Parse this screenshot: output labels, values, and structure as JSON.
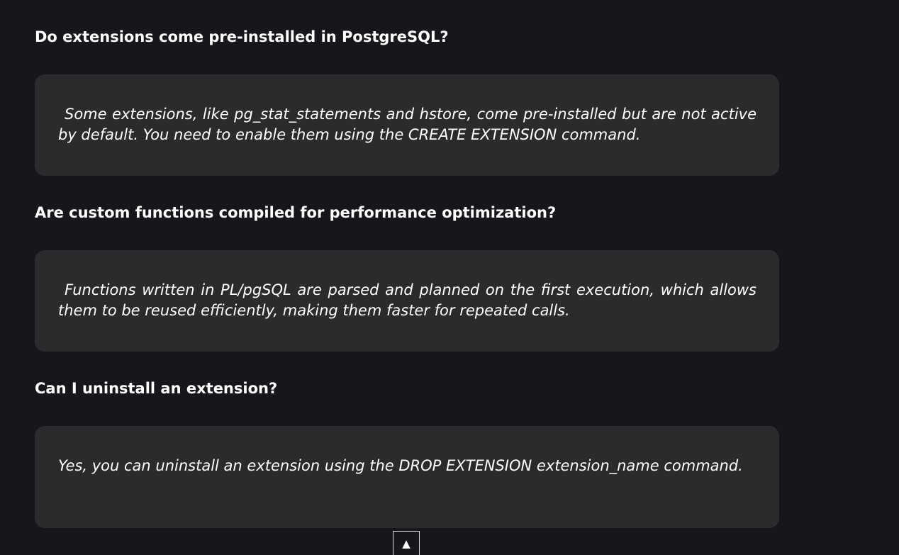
{
  "faq": [
    {
      "question": "Do extensions come pre-installed in PostgreSQL?",
      "answer": "Some extensions, like pg_stat_statements and hstore, come pre-installed but are not active by default. You need to enable them using the CREATE EXTENSION command."
    },
    {
      "question": "Are custom functions compiled for performance optimization?",
      "answer": "Functions written in PL/pgSQL are parsed and planned on the first execution, which allows them to be reused efficiently, making them faster for repeated calls."
    },
    {
      "question": "Can I uninstall an extension?",
      "answer": "Yes, you can uninstall an extension using the DROP EXTENSION extension_name command."
    }
  ],
  "scroll_top": {
    "icon": "arrow-up-icon",
    "glyph": "▲"
  },
  "colors": {
    "background": "#16171a",
    "card": "#2b2b2e",
    "text": "#ffffff"
  }
}
